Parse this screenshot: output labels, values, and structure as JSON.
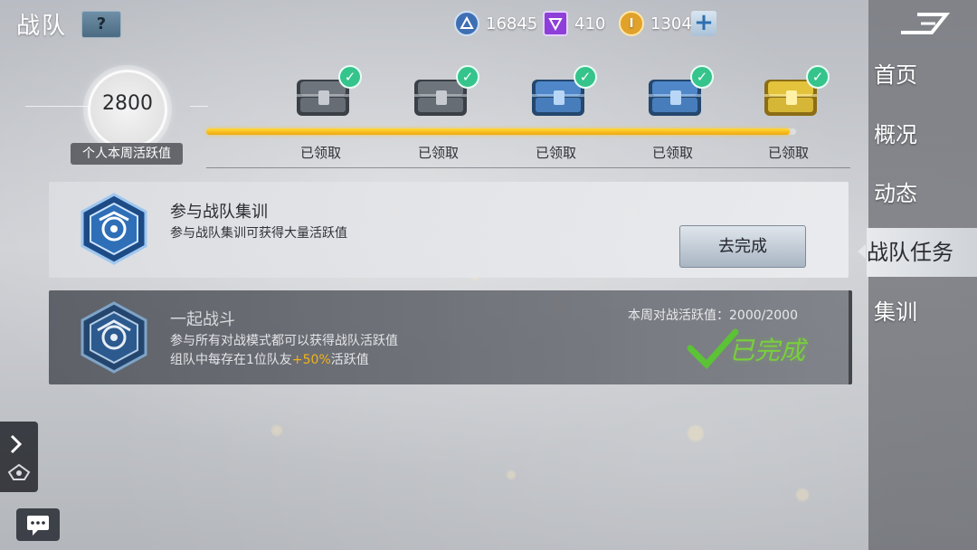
{
  "header": {
    "title": "战队",
    "help_label": "?"
  },
  "currencies": [
    {
      "icon": "triangle-badge-icon",
      "value": "16845",
      "color": "#3f6fb3"
    },
    {
      "icon": "purple-gem-icon",
      "value": "410",
      "color": "#8e3fd9"
    },
    {
      "icon": "gold-coin-icon",
      "value": "1304",
      "color": "#e0a22a"
    }
  ],
  "plus_label": "+",
  "nav": {
    "items": [
      "首页",
      "概况",
      "动态",
      "战队任务",
      "集训"
    ],
    "active_index": 3
  },
  "activity": {
    "value": "2800",
    "label": "个人本周活跃值",
    "progress_fraction": 0.99
  },
  "rewards": [
    {
      "chest": "gray-chest-icon",
      "status": "已领取",
      "claimed": true
    },
    {
      "chest": "gray-chest-icon",
      "status": "已领取",
      "claimed": true
    },
    {
      "chest": "blue-chest-icon",
      "status": "已领取",
      "claimed": true
    },
    {
      "chest": "blue-chest-icon",
      "status": "已领取",
      "claimed": true
    },
    {
      "chest": "gold-chest-icon",
      "status": "已领取",
      "claimed": true
    }
  ],
  "tasks": [
    {
      "title": "参与战队集训",
      "desc": "参与战队集训可获得大量活跃值",
      "button": "去完成"
    },
    {
      "title": "一起战斗",
      "desc_line1": "参与所有对战模式都可以获得战队活跃值",
      "desc_line2_prefix": "组队中每存在1位队友",
      "desc_line2_highlight": "+50%",
      "desc_line2_suffix": "活跃值",
      "weekly_label": "本周对战活跃值：2000/2000",
      "status": "已完成"
    }
  ],
  "colors": {
    "accent_yellow": "#f3b21a",
    "done_green": "#78d03a",
    "check_green": "#35c48b"
  }
}
